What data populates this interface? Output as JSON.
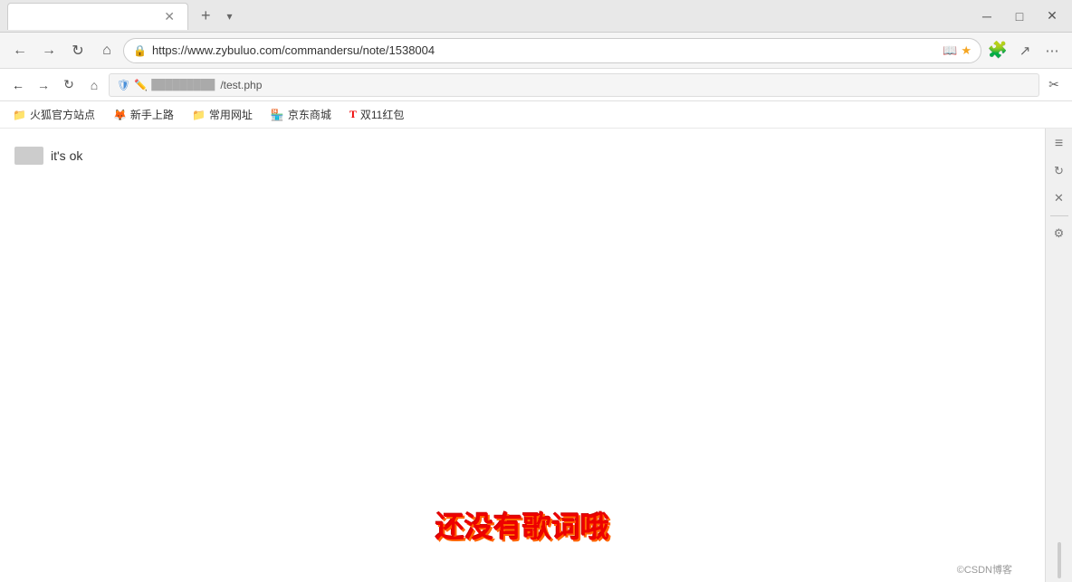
{
  "titlebar": {
    "tab_title": "",
    "new_tab_label": "+",
    "tab_list_label": "▾",
    "minimize_label": "─",
    "maximize_label": "□",
    "close_label": "✕"
  },
  "navbar": {
    "back_label": "←",
    "forward_label": "→",
    "refresh_label": "↻",
    "home_label": "⌂",
    "address": "https://www.zybuluo.com/commandersu/note/1538004",
    "star_label": "★",
    "extensions_label": "⚙",
    "share_label": "↗",
    "menu_label": "⋯"
  },
  "inner_navbar": {
    "back_label": "←",
    "forward_label": "→",
    "refresh_label": "↻",
    "home_label": "⌂",
    "shield_label": "🛡",
    "address": "/test.php",
    "screenshot_label": "✂"
  },
  "bookmarks": {
    "items": [
      {
        "icon": "📁",
        "label": "火狐官方站点"
      },
      {
        "icon": "🦊",
        "label": "新手上路"
      },
      {
        "icon": "📁",
        "label": "常用网址"
      },
      {
        "icon": "🏪",
        "label": "京东商城"
      },
      {
        "icon": "T",
        "label": "双11红包"
      }
    ]
  },
  "page": {
    "content_text": "it's ok",
    "bottom_text": "还没有歌词哦"
  },
  "right_sidebar": {
    "icons": [
      "≡",
      "↻",
      "✕",
      "⚙"
    ]
  },
  "watermark": {
    "text": "©CSDN博客"
  }
}
